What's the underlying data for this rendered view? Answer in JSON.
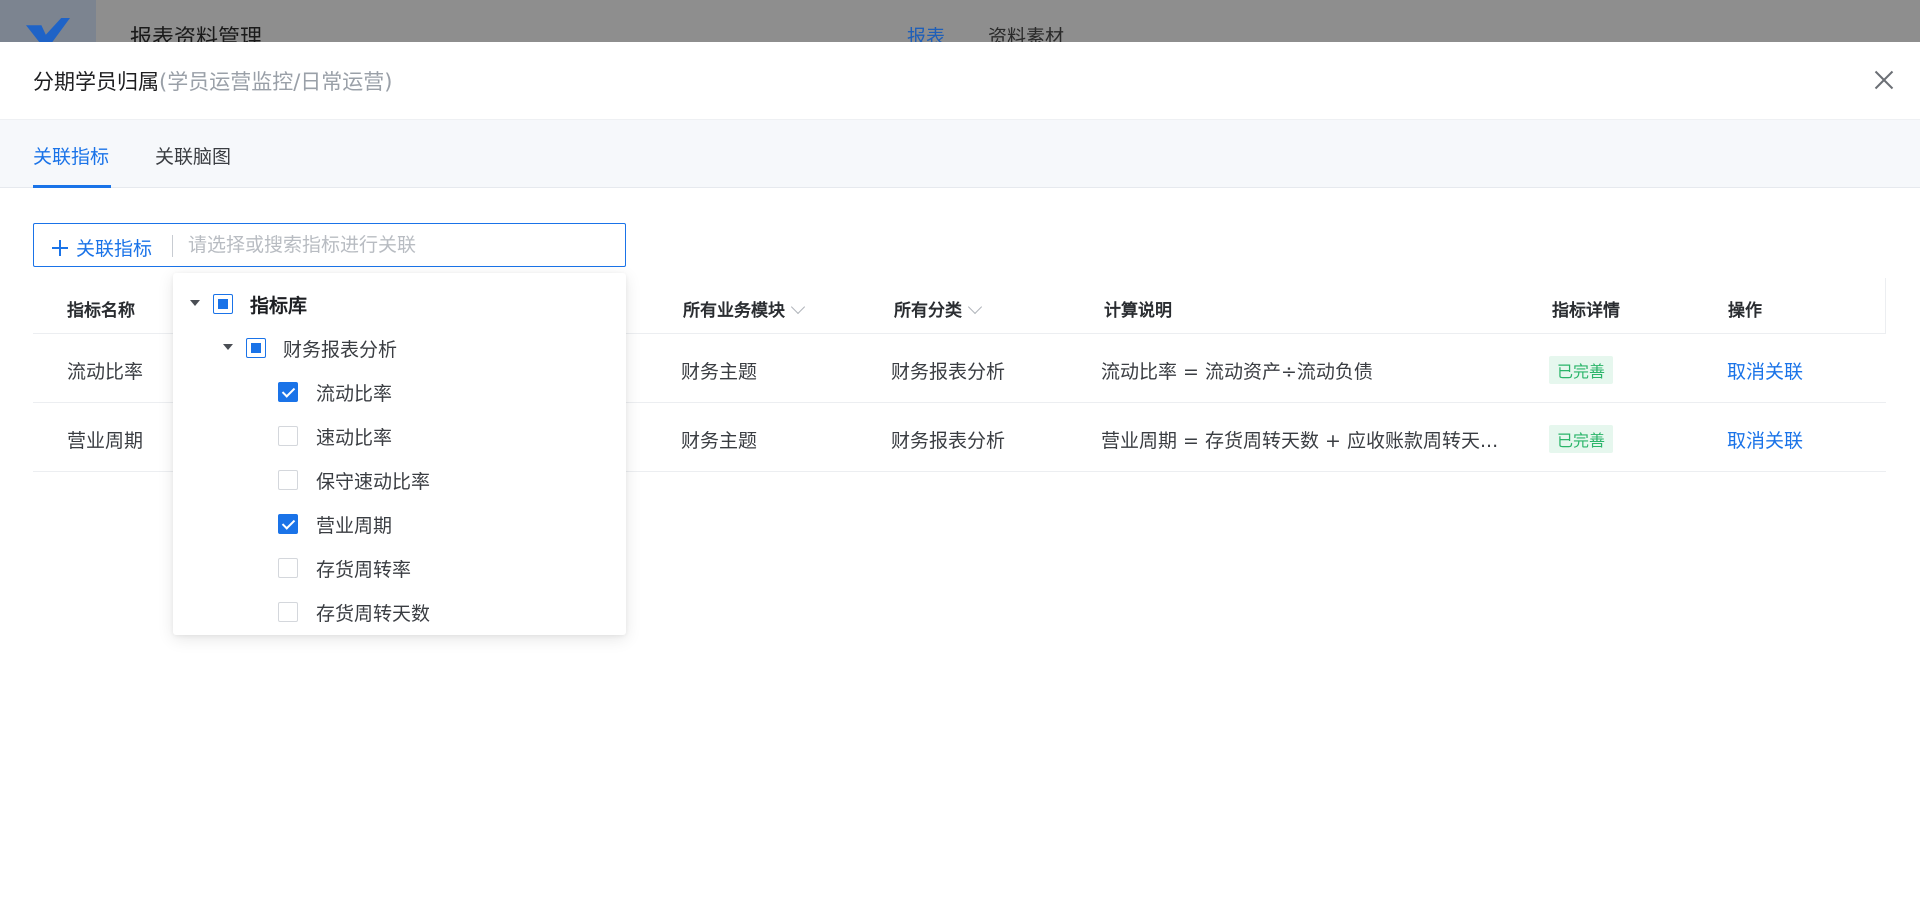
{
  "app": {
    "title": "报表资料管理",
    "nav": [
      {
        "label": "报表",
        "active": true
      },
      {
        "label": "资料素材",
        "active": false
      }
    ]
  },
  "drawer": {
    "title": "分期学员归属",
    "subtitle": "(学员运营监控/日常运营)",
    "tabs": [
      {
        "label": "关联指标",
        "active": true
      },
      {
        "label": "关联脑图",
        "active": false
      }
    ]
  },
  "link_bar": {
    "button_label": "关联指标",
    "placeholder": "请选择或搜索指标进行关联"
  },
  "table": {
    "headers": {
      "name": "指标名称",
      "module": "所有业务模块",
      "category": "所有分类",
      "calc": "计算说明",
      "detail": "指标详情",
      "action": "操作"
    },
    "rows": [
      {
        "name": "流动比率",
        "module": "财务主题",
        "category": "财务报表分析",
        "calc": "流动比率 = 流动资产÷流动负债",
        "detail": "已完善",
        "action": "取消关联"
      },
      {
        "name": "营业周期",
        "module": "财务主题",
        "category": "财务报表分析",
        "calc": "营业周期 = 存货周转天数 + 应收账款周转天...",
        "detail": "已完善",
        "action": "取消关联"
      }
    ]
  },
  "tree": {
    "root": {
      "label": "指标库",
      "state": "partial"
    },
    "group": {
      "label": "财务报表分析",
      "state": "partial"
    },
    "items": [
      {
        "label": "流动比率",
        "checked": true
      },
      {
        "label": "速动比率",
        "checked": false
      },
      {
        "label": "保守速动比率",
        "checked": false
      },
      {
        "label": "营业周期",
        "checked": true
      },
      {
        "label": "存货周转率",
        "checked": false
      },
      {
        "label": "存货周转天数",
        "checked": false
      }
    ]
  },
  "colors": {
    "accent": "#1a73e8",
    "success": "#2bb56a"
  }
}
